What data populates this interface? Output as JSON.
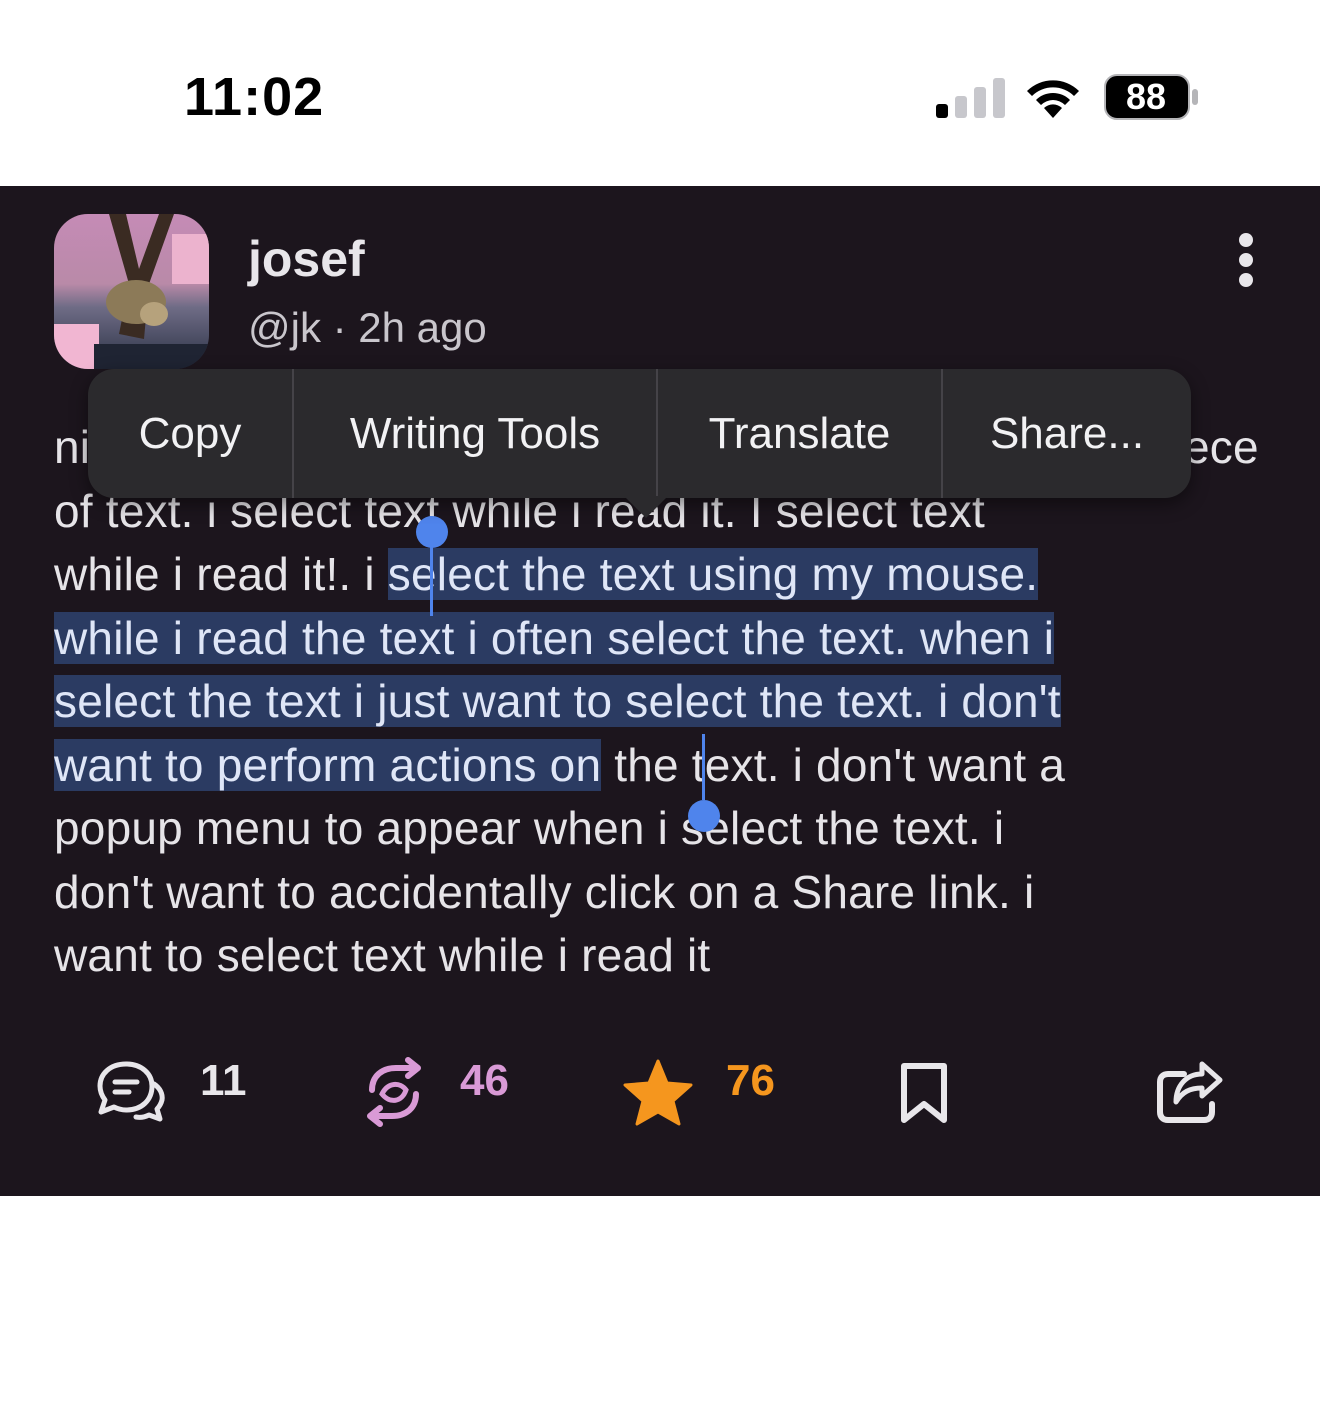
{
  "status_bar": {
    "time": "11:02",
    "battery": "88"
  },
  "post": {
    "author_name": "josef",
    "handle": "@jk",
    "age": "2h ago",
    "meta_separator": " · ",
    "text_lines": [
      {
        "pre": "ni",
        "sel": "",
        "post": "",
        "right": "ece"
      },
      {
        "pre": "of text. i select text while i read it. I select text",
        "sel": "",
        "post": ""
      },
      {
        "pre": "while i read it!. i ",
        "sel": "select the text using my mouse.",
        "post": ""
      },
      {
        "pre": "",
        "sel": "while i read the text i often select the text. when i",
        "post": ""
      },
      {
        "pre": "",
        "sel": "select the text i just want to select the text. i don't",
        "post": ""
      },
      {
        "pre": "",
        "sel": "want to perform actions on",
        "post": " the text. i don't want a"
      },
      {
        "pre": "popup menu to appear when i select the text. i",
        "sel": "",
        "post": ""
      },
      {
        "pre": "don't want to accidentally click on a Share link. i",
        "sel": "",
        "post": ""
      },
      {
        "pre": "want to select text while i read it",
        "sel": "",
        "post": ""
      }
    ],
    "reply_count": "11",
    "repost_count": "46",
    "star_count": "76"
  },
  "context_menu": {
    "items": [
      "Copy",
      "Writing Tools",
      "Translate",
      "Share..."
    ]
  },
  "colors": {
    "background": "#1c151d",
    "selection": "#2b3b62",
    "selection_handle": "#4f84ec",
    "repost_accent": "#d99ad6",
    "star_accent": "#f5961e"
  },
  "icons": [
    "signal-icon",
    "wifi-icon",
    "battery-icon",
    "more-icon",
    "reply-icon",
    "repost-icon",
    "star-icon",
    "bookmark-icon",
    "share-icon"
  ]
}
